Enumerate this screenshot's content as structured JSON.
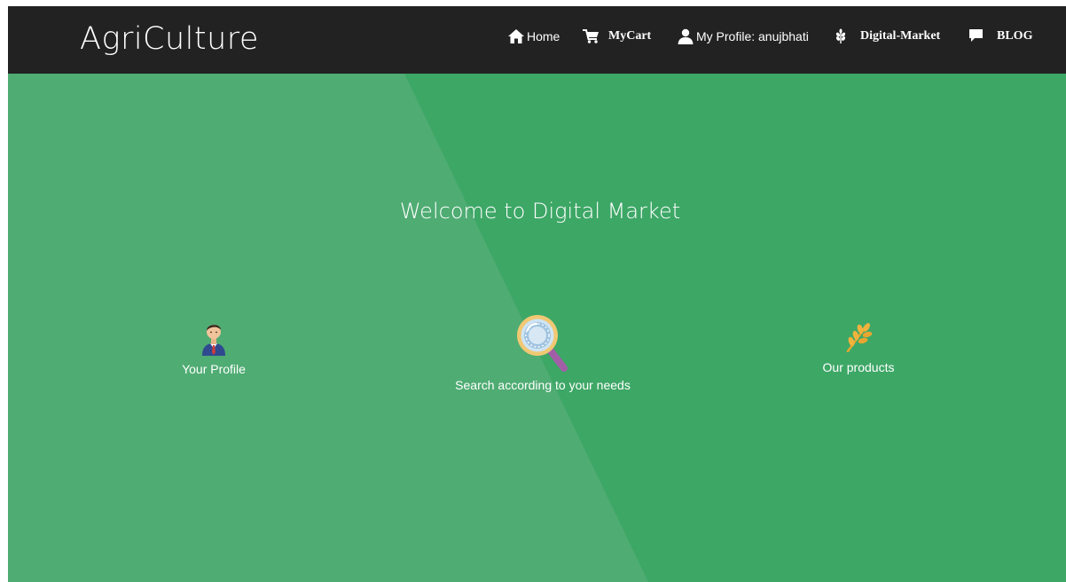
{
  "navbar": {
    "brand": "AgriCulture",
    "items": [
      {
        "label": "Home",
        "icon": "home-icon"
      },
      {
        "label": "MyCart",
        "icon": "cart-icon"
      },
      {
        "label": "My Profile: anujbhati",
        "icon": "user-icon"
      },
      {
        "label": "Digital-Market",
        "icon": "grain-icon"
      },
      {
        "label": "BLOG",
        "icon": "comment-icon"
      }
    ]
  },
  "hero": {
    "title": "Welcome to Digital Market",
    "features": [
      {
        "label": "Your Profile",
        "icon": "businessman-icon"
      },
      {
        "label": "Search according to your needs",
        "icon": "magnifier-icon"
      },
      {
        "label": "Our products",
        "icon": "wheat-icon"
      }
    ]
  },
  "colors": {
    "navbar_bg": "#222222",
    "hero_dark": "#3da766",
    "hero_light": "#4fac73",
    "text": "#ffffff"
  }
}
